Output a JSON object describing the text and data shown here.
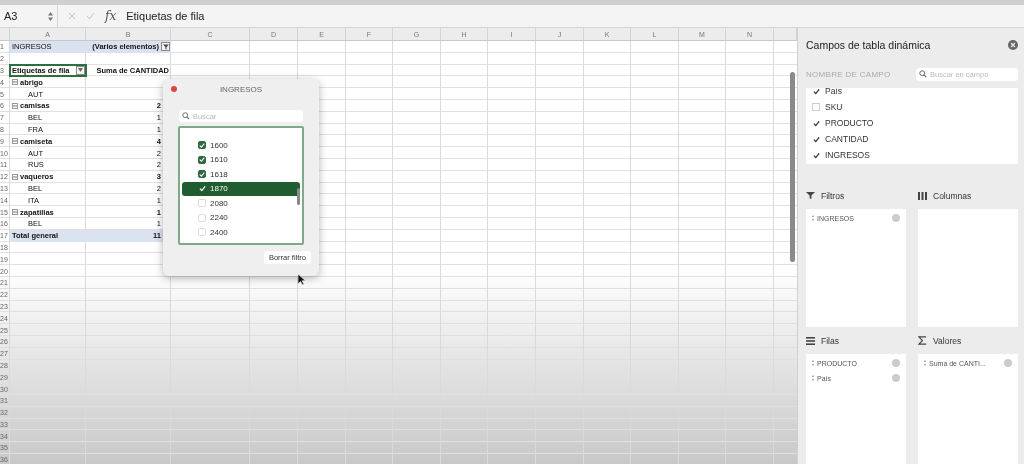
{
  "formula_bar": {
    "name_box": "A3",
    "fx": "fx",
    "formula": "Etiquetas de fila"
  },
  "columns": [
    "A",
    "B",
    "C",
    "D",
    "E",
    "F",
    "G",
    "H",
    "I",
    "J",
    "K",
    "L",
    "M",
    "N"
  ],
  "rows": [
    {
      "number": "1",
      "kind": "filter",
      "a": "INGRESOS",
      "b": "(Varios elementos)"
    },
    {
      "number": "2",
      "kind": "empty"
    },
    {
      "number": "3",
      "kind": "header",
      "a": "Etiquetas de fila",
      "b": "Suma de CANTIDAD",
      "selected": true
    },
    {
      "number": "4",
      "kind": "group",
      "a": "abrigo",
      "b": "",
      "expanded": true
    },
    {
      "number": "5",
      "kind": "item",
      "a": "AUT",
      "b": ""
    },
    {
      "number": "6",
      "kind": "group",
      "a": "camisas",
      "b": "2",
      "expanded": true
    },
    {
      "number": "7",
      "kind": "item",
      "a": "BEL",
      "b": "1"
    },
    {
      "number": "8",
      "kind": "item",
      "a": "FRA",
      "b": "1"
    },
    {
      "number": "9",
      "kind": "group",
      "a": "camiseta",
      "b": "4",
      "expanded": true
    },
    {
      "number": "10",
      "kind": "item",
      "a": "AUT",
      "b": "2"
    },
    {
      "number": "11",
      "kind": "item",
      "a": "RUS",
      "b": "2"
    },
    {
      "number": "12",
      "kind": "group",
      "a": "vaqueros",
      "b": "3",
      "expanded": true
    },
    {
      "number": "13",
      "kind": "item",
      "a": "BEL",
      "b": "2"
    },
    {
      "number": "14",
      "kind": "item",
      "a": "ITA",
      "b": "1"
    },
    {
      "number": "15",
      "kind": "group",
      "a": "zapatillas",
      "b": "1",
      "expanded": true
    },
    {
      "number": "16",
      "kind": "item",
      "a": "BEL",
      "b": "1"
    },
    {
      "number": "17",
      "kind": "total",
      "a": "Total general",
      "b": "11"
    },
    {
      "number": "18",
      "kind": "empty"
    },
    {
      "number": "19",
      "kind": "empty"
    },
    {
      "number": "20",
      "kind": "empty"
    },
    {
      "number": "21",
      "kind": "empty"
    },
    {
      "number": "22",
      "kind": "empty"
    },
    {
      "number": "23",
      "kind": "empty"
    },
    {
      "number": "24",
      "kind": "empty"
    },
    {
      "number": "25",
      "kind": "empty"
    },
    {
      "number": "26",
      "kind": "empty"
    },
    {
      "number": "27",
      "kind": "empty"
    },
    {
      "number": "28",
      "kind": "empty"
    },
    {
      "number": "29",
      "kind": "empty"
    },
    {
      "number": "30",
      "kind": "empty"
    },
    {
      "number": "31",
      "kind": "empty"
    },
    {
      "number": "32",
      "kind": "empty"
    },
    {
      "number": "33",
      "kind": "empty"
    },
    {
      "number": "34",
      "kind": "empty"
    },
    {
      "number": "35",
      "kind": "empty"
    },
    {
      "number": "36",
      "kind": "empty"
    }
  ],
  "filter_popup": {
    "title": "INGRESOS",
    "search": {
      "placeholder": "Buscar"
    },
    "items": [
      {
        "label": "1600",
        "checked": true,
        "selected": false
      },
      {
        "label": "1610",
        "checked": true,
        "selected": false
      },
      {
        "label": "1618",
        "checked": true,
        "selected": false
      },
      {
        "label": "1870",
        "checked": true,
        "selected": true
      },
      {
        "label": "2080",
        "checked": false,
        "selected": false
      },
      {
        "label": "2240",
        "checked": false,
        "selected": false
      },
      {
        "label": "2400",
        "checked": false,
        "selected": false
      }
    ],
    "clear_button": "Borrar filtro"
  },
  "pivot_panel": {
    "title": "Campos de tabla dinámica",
    "field_header": "NOMBRE DE CAMPO",
    "search": {
      "placeholder": "Buscar en campo"
    },
    "fields": [
      {
        "label": "País",
        "checked": true
      },
      {
        "label": "SKU",
        "checked": false
      },
      {
        "label": "PRODUCTO",
        "checked": true
      },
      {
        "label": "CANTIDAD",
        "checked": true
      },
      {
        "label": "INGRESOS",
        "checked": true
      }
    ],
    "areas": [
      {
        "kind": "filters",
        "title": "Filtros",
        "items": [
          "INGRESOS"
        ]
      },
      {
        "kind": "columns",
        "title": "Columnas"
      },
      {
        "kind": "rows",
        "title": "Filas",
        "items": [
          "PRODUCTO",
          "País"
        ]
      },
      {
        "kind": "values",
        "title": "Valores",
        "items": [
          "Suma de CANTI..."
        ]
      }
    ]
  }
}
